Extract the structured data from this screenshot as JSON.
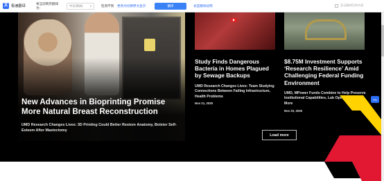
{
  "translate_bar": {
    "app_name": "极速翻译",
    "label": "将当前网页翻译为：",
    "language_value": "中文(简体)",
    "source_label": "检测不到",
    "source_link": "更改为切换原文显示",
    "translate_button": "翻译",
    "always_translate_link": "总是翻译此网",
    "no_prompt_label": "显示翻译后的内容"
  },
  "feature": {
    "title": "New Advances in Bioprinting Promise More Natural Breast Reconstruction",
    "description": "UMD Research Changes Lives: 3D Printing Could Better Restore Anatomy, Bolster Self-Esteem After Mastectomy"
  },
  "cards": [
    {
      "title": "Study Finds Dangerous Bacteria in Homes Plagued by Sewage Backups",
      "description": "UMD Research Changes Lives: Team Studying Connections Between Failing Infrastructure, Health Problems",
      "date": "Nov 21, 2025"
    },
    {
      "title": "$8.75M Investment Supports ‘Research Resilience’ Amid Challenging Federal Funding Environment",
      "description": "UMD, MPower Funds Combine to Help Preserve Institutional Capabilities, Lab Operations and More",
      "date": "Nov 20, 2025"
    }
  ],
  "load_more": "Load more",
  "side_button": "EN",
  "colors": {
    "accent_red": "#e21833",
    "accent_gold": "#ffd200",
    "translate_blue": "#3b82f6"
  }
}
